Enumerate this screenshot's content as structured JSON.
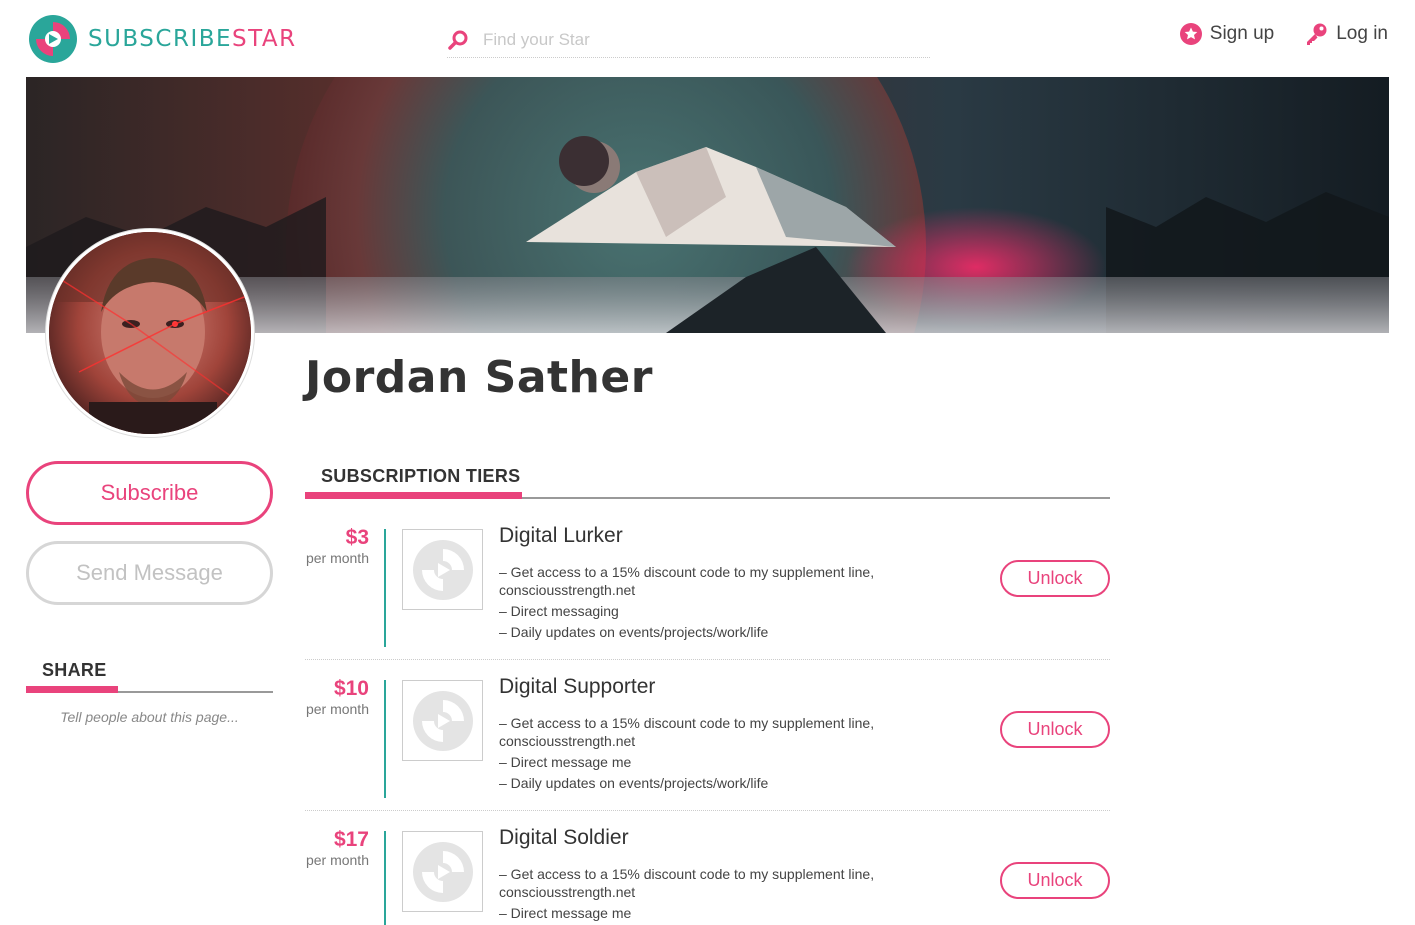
{
  "header": {
    "logo_sub": "SUBSCRIBE",
    "logo_star": "STAR",
    "search_placeholder": "Find your Star",
    "signup_label": "Sign up",
    "login_label": "Log in"
  },
  "profile": {
    "name": "Jordan Sather",
    "subscribe_label": "Subscribe",
    "message_label": "Send Message"
  },
  "share": {
    "title": "SHARE",
    "text": "Tell people about this page..."
  },
  "tiers": {
    "title": "SUBSCRIPTION TIERS",
    "items": [
      {
        "price": "$3",
        "period": "per month",
        "name": "Digital Lurker",
        "features": [
          "– Get access to a 15% discount code to my supplement line, consciousstrength.net",
          "– Direct messaging",
          "– Daily updates on events/projects/work/life"
        ],
        "button": "Unlock"
      },
      {
        "price": "$10",
        "period": "per month",
        "name": "Digital Supporter",
        "features": [
          "– Get access to a 15% discount code to my supplement line, consciousstrength.net",
          "– Direct message me",
          "– Daily updates on events/projects/work/life"
        ],
        "button": "Unlock"
      },
      {
        "price": "$17",
        "period": "per month",
        "name": "Digital Soldier",
        "features": [
          "– Get access to a 15% discount code to my supplement line, consciousstrength.net",
          "– Direct message me"
        ],
        "button": "Unlock"
      }
    ]
  },
  "colors": {
    "accent": "#e9437c",
    "brand_teal": "#2aa69a"
  },
  "icons": {
    "search": "search-icon",
    "signup": "star-badge-icon",
    "login": "key-icon",
    "tier_placeholder": "subscribestar-placeholder-icon"
  }
}
